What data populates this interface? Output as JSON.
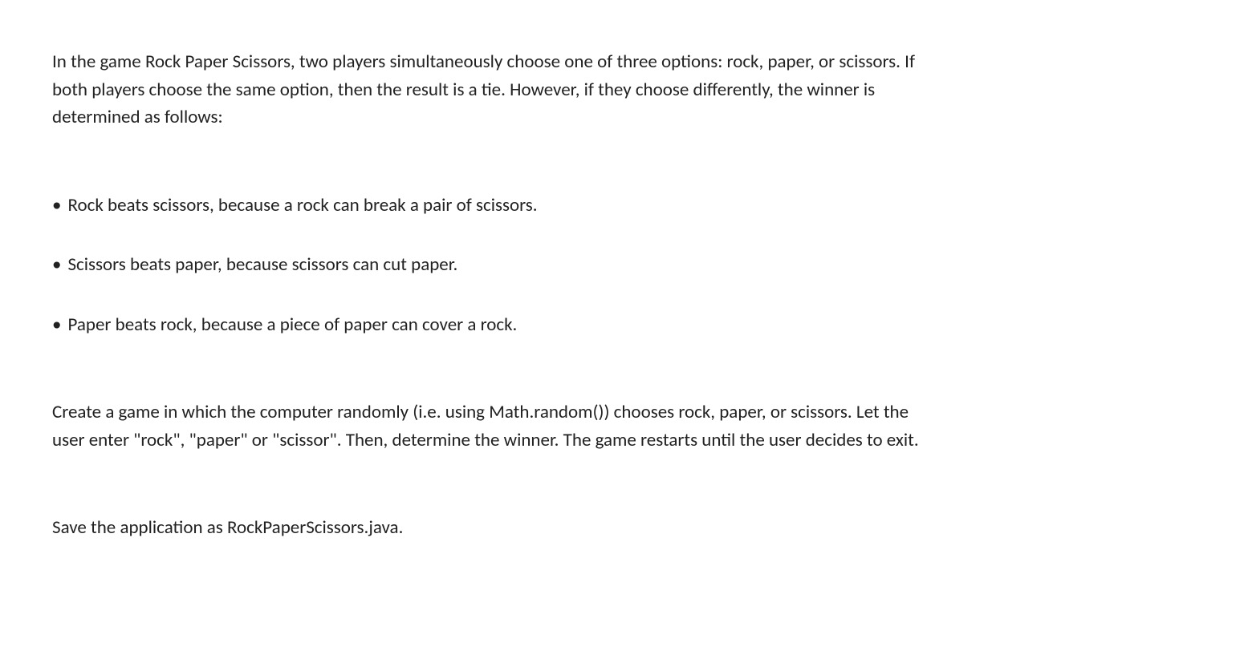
{
  "intro": "In the game Rock Paper Scissors, two players simultaneously choose one of three options: rock, paper, or scissors. If both players choose the same option, then the result is a tie. However, if they choose differently, the winner is determined as follows:",
  "bullets": [
    "Rock beats scissors, because a rock can break a pair of scissors.",
    "Scissors beats paper, because scissors can cut paper.",
    "Paper beats rock, because a piece of paper can cover a rock."
  ],
  "instruction": "Create a game in which the computer randomly (i.e. using Math.random()) chooses rock, paper, or scissors. Let the user enter \"rock\", \"paper\" or \"scissor\". Then,  determine the winner. The game restarts until the user decides to exit.",
  "save_instruction": "Save the application as RockPaperScissors.java.",
  "bullet_char": "•"
}
